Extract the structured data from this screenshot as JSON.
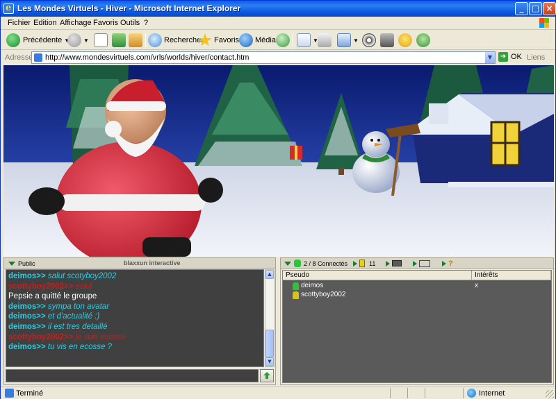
{
  "window": {
    "title": "Les Mondes Virtuels - Hiver - Microsoft Internet Explorer",
    "buttons": {
      "minimize": "_",
      "maximize": "□",
      "close": "×"
    }
  },
  "menu": [
    "Fichier",
    "Edition",
    "Affichage",
    "Favoris",
    "Outils",
    "?"
  ],
  "toolbar": {
    "back_label": "Précédente",
    "search_label": "Rechercher",
    "favorites_label": "Favoris",
    "media_label": "Média"
  },
  "address": {
    "label": "Adresse",
    "url": "http://www.mondesvirtuels.com/vrls/worlds/hiver/contact.htm",
    "go_label": "OK",
    "links_label": "Liens"
  },
  "chat": {
    "tab_label": "Public",
    "brand": "blaxxun interactive",
    "messages": [
      {
        "user": "deimos>>",
        "text": " salut scotyboy2002",
        "user_color": "#22cfe6",
        "text_color": "#22cfe6",
        "italic": true
      },
      {
        "user": "scottyboy2002>>",
        "text": " salut",
        "user_color": "#c81e1e",
        "text_color": "#c81e1e",
        "italic": true
      },
      {
        "user": "",
        "text": "Pepsie a quitté le groupe",
        "user_color": "#ffffff",
        "text_color": "#ffffff",
        "italic": false
      },
      {
        "user": "deimos>>",
        "text": " sympa ton avatar",
        "user_color": "#22cfe6",
        "text_color": "#22cfe6",
        "italic": true
      },
      {
        "user": "deimos>>",
        "text": " et d'actualité :)",
        "user_color": "#22cfe6",
        "text_color": "#22cfe6",
        "italic": true
      },
      {
        "user": "deimos>>",
        "text": " il est tres detaillé",
        "user_color": "#22cfe6",
        "text_color": "#22cfe6",
        "italic": true
      },
      {
        "user": "scottyboy2002>>",
        "text": " je suis ecosse",
        "user_color": "#c81e1e",
        "text_color": "#c81e1e",
        "italic": true
      },
      {
        "user": "deimos>>",
        "text": " tu vis en ecosse ?",
        "user_color": "#22cfe6",
        "text_color": "#22cfe6",
        "italic": true
      }
    ]
  },
  "users_panel": {
    "connected": "2 / 8 Connectés",
    "count_2": "11",
    "columns": [
      "Pseudo",
      "Intérêts"
    ],
    "users": [
      {
        "name": "deimos",
        "interests": "x",
        "color": "#2ec43a"
      },
      {
        "name": "scottyboy2002",
        "interests": "",
        "color": "#d8c21e"
      }
    ]
  },
  "status": {
    "left": "Terminé",
    "zone": "Internet"
  }
}
